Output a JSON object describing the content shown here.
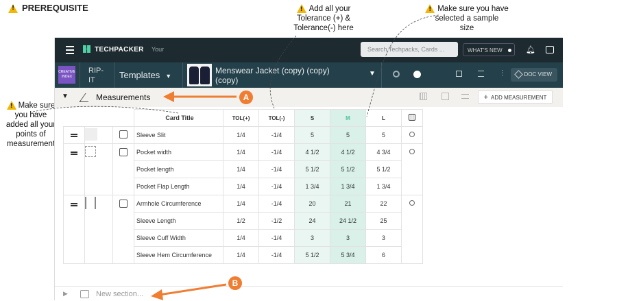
{
  "prerequisite": {
    "title": "PREREQUISITE"
  },
  "notes": {
    "tolerance": [
      "Add all your",
      "Tolerance (+) &",
      "Tolerance(-) here"
    ],
    "sample_size": [
      "Make sure you have",
      "selected a sample",
      "size"
    ],
    "points": [
      "Make sure",
      "you have",
      "added all your",
      "points of",
      "measurement"
    ]
  },
  "topbar": {
    "brand": "TECHPACKER",
    "your": "Your",
    "search_placeholder": "Search Techpacks, Cards ...",
    "whats_new": "WHAT'S NEW"
  },
  "subbar": {
    "brand_image_text": "CREATIVE INDEX",
    "project": [
      "RIP-",
      "IT"
    ],
    "templates": "Templates",
    "product_title": [
      "Menswear Jacket (copy) (copy)",
      "(copy)"
    ],
    "doc_view": "DOC VIEW"
  },
  "section": {
    "title": "Measurements",
    "add_button": "ADD MEASUREMENT",
    "new_section": "New section..."
  },
  "callouts": {
    "a": "A",
    "b": "B"
  },
  "table": {
    "headers": {
      "card_title": "Card Title",
      "tol_plus": "TOL(+)",
      "tol_minus": "TOL(-)",
      "sizes": [
        "S",
        "M",
        "L"
      ]
    },
    "groups": [
      {
        "rows": [
          {
            "title": "Sleeve Slit",
            "tol_plus": "1/4",
            "tol_minus": "-1/4",
            "s": "5",
            "m": "5",
            "l": "5"
          }
        ]
      },
      {
        "rows": [
          {
            "title": "Pocket width",
            "tol_plus": "1/4",
            "tol_minus": "-1/4",
            "s": "4 1/2",
            "m": "4 1/2",
            "l": "4 3/4"
          },
          {
            "title": "Pocket length",
            "tol_plus": "1/4",
            "tol_minus": "-1/4",
            "s": "5 1/2",
            "m": "5 1/2",
            "l": "5 1/2"
          },
          {
            "title": "Pocket Flap Length",
            "tol_plus": "1/4",
            "tol_minus": "-1/4",
            "s": "1 3/4",
            "m": "1 3/4",
            "l": "1 3/4"
          }
        ]
      },
      {
        "rows": [
          {
            "title": "Armhole Circumference",
            "tol_plus": "1/4",
            "tol_minus": "-1/4",
            "s": "20",
            "m": "21",
            "l": "22"
          },
          {
            "title": "Sleeve Length",
            "tol_plus": "1/2",
            "tol_minus": "-1/2",
            "s": "24",
            "m": "24 1/2",
            "l": "25"
          },
          {
            "title": "Sleeve Cuff Width",
            "tol_plus": "1/4",
            "tol_minus": "-1/4",
            "s": "3",
            "m": "3",
            "l": "3"
          },
          {
            "title": "Sleeve Hem Circumference",
            "tol_plus": "1/4",
            "tol_minus": "-1/4",
            "s": "5 1/2",
            "m": "5 3/4",
            "l": "6"
          }
        ]
      }
    ]
  },
  "colors": {
    "topbar": "#1d2a30",
    "subbar": "#24404a",
    "accent": "#ef7d32",
    "size_highlight": "#d9f1e9",
    "warning": "#f2b705"
  }
}
